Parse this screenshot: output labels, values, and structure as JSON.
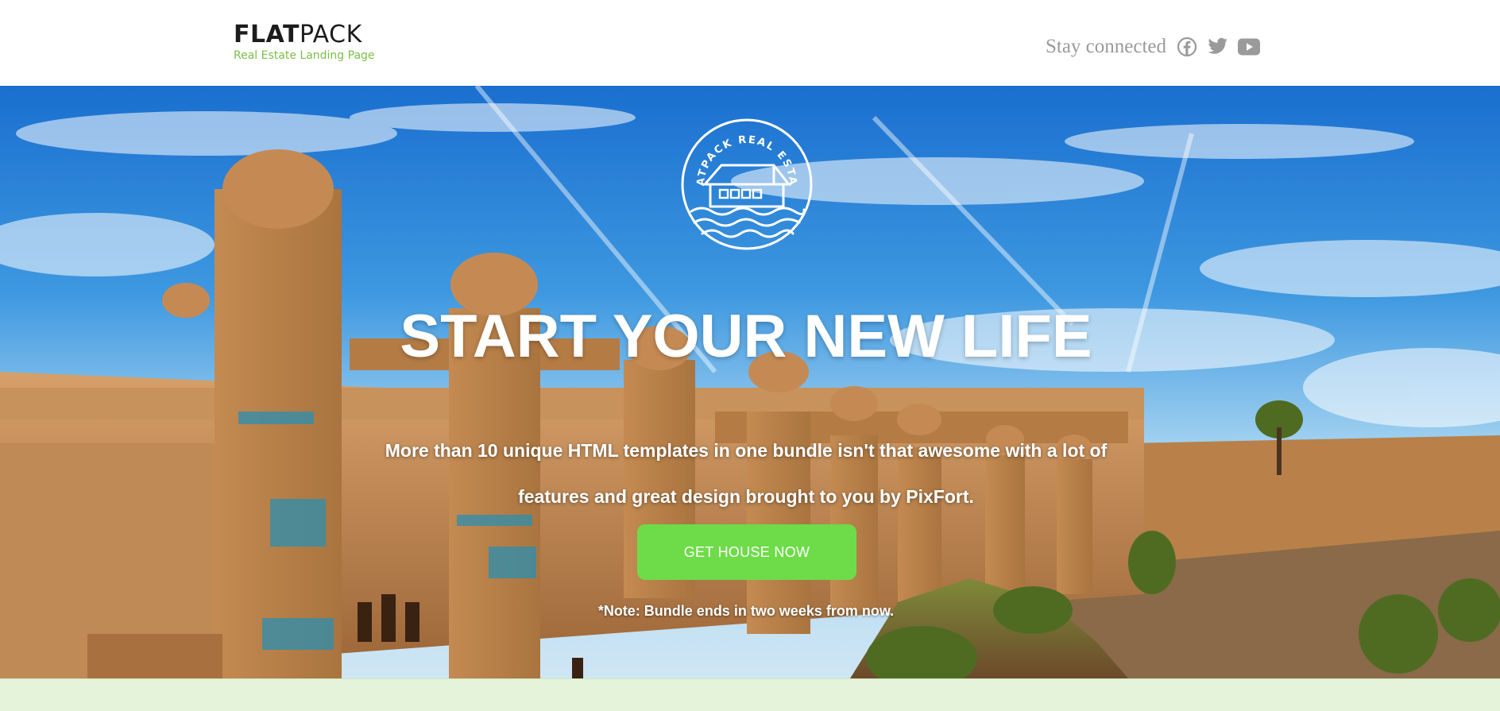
{
  "brand": {
    "title_bold": "FLAT",
    "title_light": "PACK",
    "subtitle": "Real Estate Landing Page",
    "accent_color": "#7bbf4a"
  },
  "header": {
    "social_label": "Stay connected",
    "social_icons": [
      "facebook-icon",
      "twitter-icon",
      "youtube-icon"
    ]
  },
  "hero": {
    "badge_text": "FLATPACK REAL ESTATE",
    "headline": "START YOUR NEW LIFE",
    "subtext": "More than 10 unique HTML templates in one bundle isn't that awesome with a lot of features and great design brought to you by PixFort.",
    "cta_label": "GET HOUSE NOW",
    "cta_color": "#6ddc48",
    "note": "*Note: Bundle ends in two weeks from now."
  },
  "footer_strip": {
    "color": "#e5f3db"
  }
}
